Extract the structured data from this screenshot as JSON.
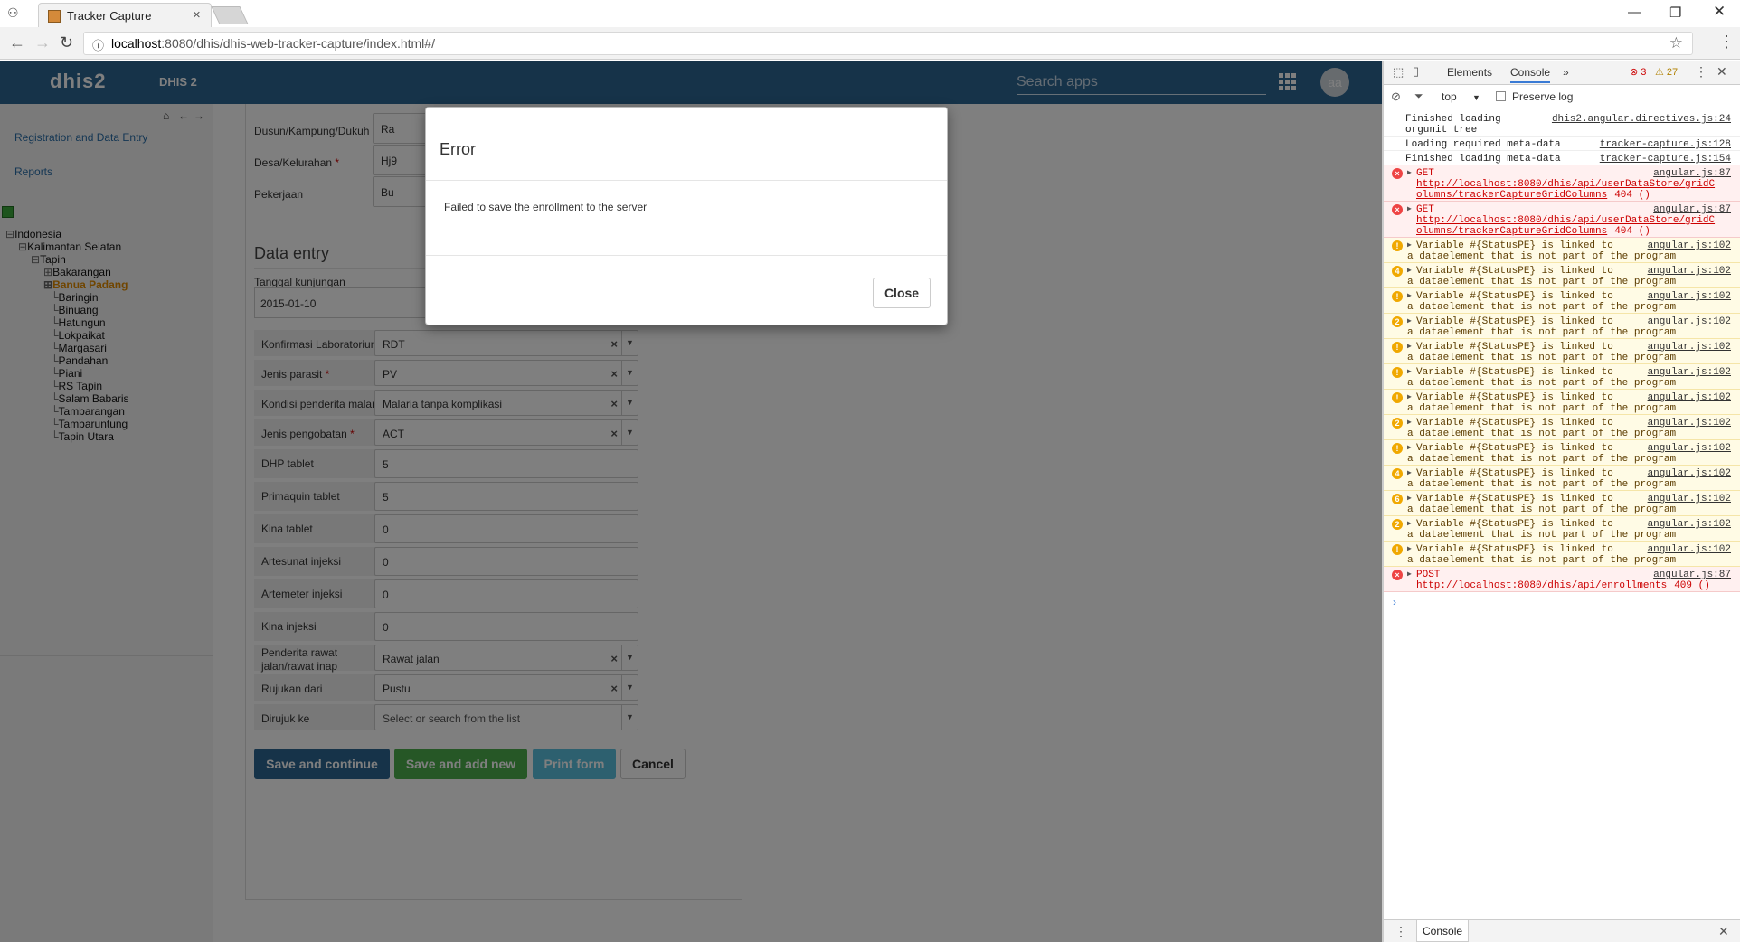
{
  "browser": {
    "tab_title": "Tracker Capture",
    "url_host": "localhost",
    "url_rest": ":8080/dhis/dhis-web-tracker-capture/index.html#/"
  },
  "header": {
    "logo": "dhis2",
    "app_name": "DHIS 2",
    "search_placeholder": "Search apps",
    "avatar": "aa"
  },
  "sidebar": {
    "links": [
      "Registration and Data Entry",
      "Reports"
    ],
    "tree": [
      {
        "label": "Indonesia",
        "prefix": "⊟"
      },
      {
        "label": "Kalimantan Selatan",
        "prefix": "⊟"
      },
      {
        "label": "Tapin",
        "prefix": "⊟"
      },
      {
        "label": "Bakarangan",
        "prefix": "⊞"
      },
      {
        "label": "Banua Padang",
        "prefix": "⊞",
        "selected": true
      },
      {
        "label": "Baringin",
        "prefix": "└"
      },
      {
        "label": "Binuang",
        "prefix": "└"
      },
      {
        "label": "Hatungun",
        "prefix": "└"
      },
      {
        "label": "Lokpaikat",
        "prefix": "└"
      },
      {
        "label": "Margasari",
        "prefix": "└"
      },
      {
        "label": "Pandahan",
        "prefix": "└"
      },
      {
        "label": "Piani",
        "prefix": "└"
      },
      {
        "label": "RS Tapin",
        "prefix": "└"
      },
      {
        "label": "Salam Babaris",
        "prefix": "└"
      },
      {
        "label": "Tambarangan",
        "prefix": "└"
      },
      {
        "label": "Tambaruntung",
        "prefix": "└"
      },
      {
        "label": "Tapin Utara",
        "prefix": "└"
      }
    ]
  },
  "form": {
    "top_fields": [
      {
        "label": "Dusun/Kampung/Dukuh",
        "required": true,
        "value": "Ra"
      },
      {
        "label": "Desa/Kelurahan",
        "required": true,
        "value": "Hj9"
      },
      {
        "label": "Pekerjaan",
        "required": false,
        "value": "Bu"
      }
    ],
    "section_title": "Data entry",
    "date_label": "Tanggal kunjungan",
    "date_value": "2015-01-10",
    "fields": [
      {
        "label": "Konfirmasi Laboratorium",
        "required": true,
        "value": "RDT",
        "select": true
      },
      {
        "label": "Jenis parasit",
        "required": true,
        "value": "PV",
        "select": true
      },
      {
        "label": "Kondisi penderita malaria",
        "required": false,
        "value": "Malaria tanpa komplikasi",
        "select": true
      },
      {
        "label": "Jenis pengobatan",
        "required": true,
        "value": "ACT",
        "select": true
      },
      {
        "label": "DHP tablet",
        "required": false,
        "value": "5",
        "select": false
      },
      {
        "label": "Primaquin tablet",
        "required": false,
        "value": "5",
        "select": false
      },
      {
        "label": "Kina tablet",
        "required": false,
        "value": "0",
        "select": false
      },
      {
        "label": "Artesunat injeksi",
        "required": false,
        "value": "0",
        "select": false
      },
      {
        "label": "Artemeter injeksi",
        "required": false,
        "value": "0",
        "select": false
      },
      {
        "label": "Kina injeksi",
        "required": false,
        "value": "0",
        "select": false
      },
      {
        "label": "Penderita rawat jalan/rawat inap",
        "required": false,
        "value": "Rawat jalan",
        "select": true
      },
      {
        "label": "Rujukan dari",
        "required": false,
        "value": "Pustu",
        "select": true
      },
      {
        "label": "Dirujuk ke",
        "required": false,
        "value": "Select or search from the list",
        "select": true,
        "empty": true
      }
    ],
    "buttons": {
      "save_continue": "Save and continue",
      "save_add_new": "Save and add new",
      "print": "Print form",
      "cancel": "Cancel"
    },
    "colors": {
      "primary": "#2c6693",
      "success": "#4cae4c",
      "info": "#5bc0de"
    }
  },
  "modal": {
    "title": "Error",
    "message": "Failed to save the enrollment to the server",
    "close": "Close"
  },
  "devtools": {
    "tabs": [
      "Elements",
      "Console"
    ],
    "error_count": "3",
    "warn_count": "27",
    "context": "top",
    "preserve_log": "Preserve log",
    "bottom_tab": "Console",
    "logs": [
      {
        "type": "info",
        "lines": [
          "Finished loading",
          "orgunit tree"
        ],
        "src": "dhis2.angular.directives.js:24"
      },
      {
        "type": "info",
        "lines": [
          "Loading required meta-data"
        ],
        "src": "tracker-capture.js:128"
      },
      {
        "type": "info",
        "lines": [
          "Finished loading meta-data"
        ],
        "src": "tracker-capture.js:154"
      },
      {
        "type": "err",
        "method": "GET",
        "lines": [
          "http://localhost:8080/dhis/api/userDataStore/gridC",
          "olumns/trackerCaptureGridColumns"
        ],
        "status": "404 ()",
        "src": "angular.js:87"
      },
      {
        "type": "err",
        "method": "GET",
        "lines": [
          "http://localhost:8080/dhis/api/userDataStore/gridC",
          "olumns/trackerCaptureGridColumns"
        ],
        "status": "404 ()",
        "src": "angular.js:87"
      },
      {
        "type": "warn",
        "badge": "⚠",
        "lines": [
          "Variable #{StatusPE} is linked to",
          "a dataelement that is not part of the program"
        ],
        "src": "angular.js:102"
      },
      {
        "type": "warn",
        "badge": "4",
        "lines": [
          "Variable #{StatusPE} is linked to",
          "a dataelement that is not part of the program"
        ],
        "src": "angular.js:102"
      },
      {
        "type": "warn",
        "badge": "⚠",
        "lines": [
          "Variable #{StatusPE} is linked to",
          "a dataelement that is not part of the program"
        ],
        "src": "angular.js:102"
      },
      {
        "type": "warn",
        "badge": "2",
        "lines": [
          "Variable #{StatusPE} is linked to",
          "a dataelement that is not part of the program"
        ],
        "src": "angular.js:102"
      },
      {
        "type": "warn",
        "badge": "⚠",
        "lines": [
          "Variable #{StatusPE} is linked to",
          "a dataelement that is not part of the program"
        ],
        "src": "angular.js:102"
      },
      {
        "type": "warn",
        "badge": "⚠",
        "lines": [
          "Variable #{StatusPE} is linked to",
          "a dataelement that is not part of the program"
        ],
        "src": "angular.js:102"
      },
      {
        "type": "warn",
        "badge": "⚠",
        "lines": [
          "Variable #{StatusPE} is linked to",
          "a dataelement that is not part of the program"
        ],
        "src": "angular.js:102"
      },
      {
        "type": "warn",
        "badge": "2",
        "lines": [
          "Variable #{StatusPE} is linked to",
          "a dataelement that is not part of the program"
        ],
        "src": "angular.js:102"
      },
      {
        "type": "warn",
        "badge": "⚠",
        "lines": [
          "Variable #{StatusPE} is linked to",
          "a dataelement that is not part of the program"
        ],
        "src": "angular.js:102"
      },
      {
        "type": "warn",
        "badge": "4",
        "lines": [
          "Variable #{StatusPE} is linked to",
          "a dataelement that is not part of the program"
        ],
        "src": "angular.js:102"
      },
      {
        "type": "warn",
        "badge": "6",
        "lines": [
          "Variable #{StatusPE} is linked to",
          "a dataelement that is not part of the program"
        ],
        "src": "angular.js:102"
      },
      {
        "type": "warn",
        "badge": "2",
        "lines": [
          "Variable #{StatusPE} is linked to",
          "a dataelement that is not part of the program"
        ],
        "src": "angular.js:102"
      },
      {
        "type": "warn",
        "badge": "⚠",
        "lines": [
          "Variable #{StatusPE} is linked to",
          "a dataelement that is not part of the program"
        ],
        "src": "angular.js:102"
      },
      {
        "type": "err",
        "method": "POST",
        "lines": [
          "http://localhost:8080/dhis/api/enrollments"
        ],
        "status": "409 ()",
        "src": "angular.js:87"
      }
    ]
  }
}
